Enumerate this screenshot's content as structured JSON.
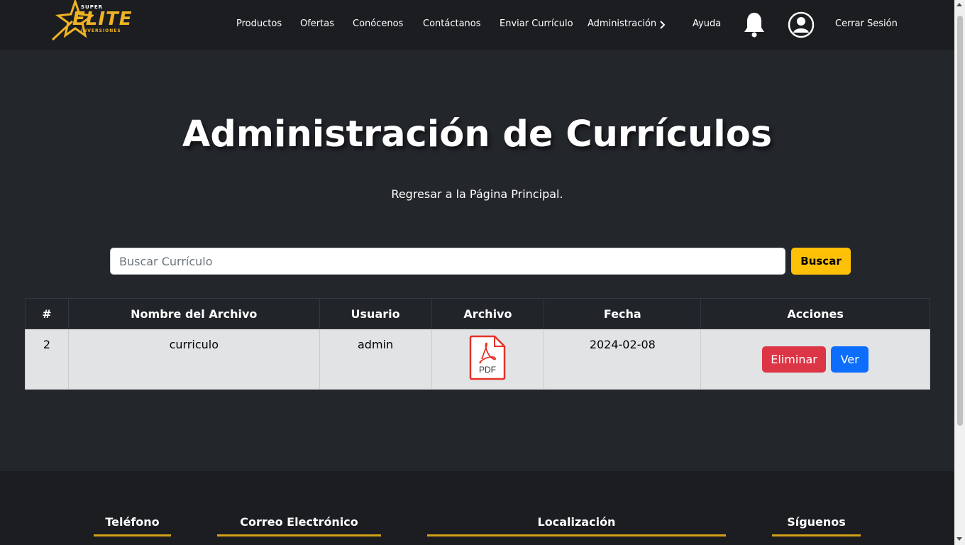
{
  "logo": {
    "top": "SUPER",
    "main": "ELITE",
    "bottom": "INVERSIONES"
  },
  "nav": {
    "items": [
      "Productos",
      "Ofertas",
      "Conócenos",
      "Contáctanos",
      "Enviar Currículo",
      "Administración",
      "Ayuda"
    ],
    "logout": "Cerrar Sesión"
  },
  "page": {
    "title": "Administración de Currículos",
    "back_link": "Regresar a la Página Principal."
  },
  "search": {
    "placeholder": "Buscar Currículo",
    "button": "Buscar"
  },
  "table": {
    "headers": [
      "#",
      "Nombre del Archivo",
      "Usuario",
      "Archivo",
      "Fecha",
      "Acciones"
    ],
    "rows": [
      {
        "id": "2",
        "name": "curriculo",
        "user": "admin",
        "file_icon": "pdf-icon",
        "file_label": "PDF",
        "date": "2024-02-08",
        "delete": "Eliminar",
        "view": "Ver"
      }
    ]
  },
  "footer": {
    "headings": [
      "Teléfono",
      "Correo Electrónico",
      "Localización",
      "Síguenos"
    ]
  },
  "colors": {
    "accent": "#ffc107",
    "danger": "#dc3545",
    "primary": "#0d6efd",
    "bg": "#23262b",
    "nav_bg": "#1b1d21"
  }
}
